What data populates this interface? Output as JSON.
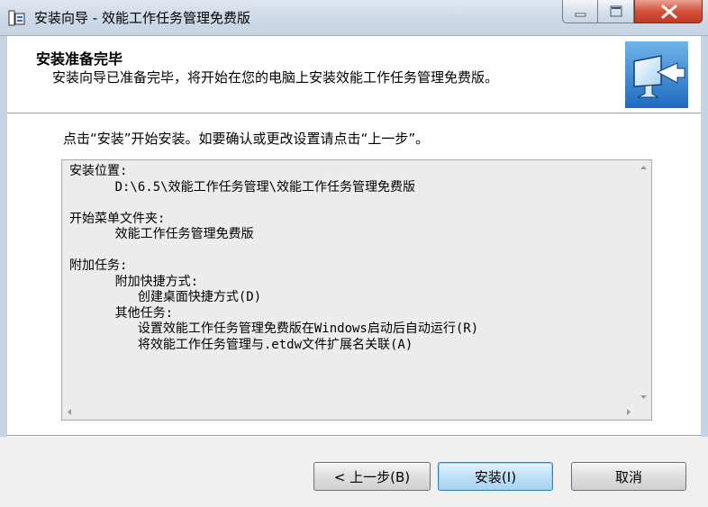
{
  "window": {
    "title": "安装向导 - 效能工作任务管理免费版"
  },
  "header": {
    "title": "安装准备完毕",
    "description": "安装向导已准备完毕，将开始在您的电脑上安装效能工作任务管理免费版。"
  },
  "body": {
    "instruction": "点击“安装”开始安装。如要确认或更改设置请点击“上一步”。",
    "memo_lines": [
      "安装位置:",
      "      D:\\6.5\\效能工作任务管理\\效能工作任务管理免费版",
      "",
      "开始菜单文件夹:",
      "      效能工作任务管理免费版",
      "",
      "附加任务:",
      "      附加快捷方式:",
      "         创建桌面快捷方式(D)",
      "      其他任务:",
      "         设置效能工作任务管理免费版在Windows启动后自动运行(R)",
      "         将效能工作任务管理与.etdw文件扩展名关联(A)"
    ]
  },
  "buttons": {
    "back": "< 上一步(B)",
    "install": "安装(I)",
    "cancel": "取消"
  },
  "icons": {
    "app": "installer-icon",
    "minimize": "minimize-icon",
    "maximize": "maximize-icon",
    "close": "close-icon",
    "header": "computer-install-icon"
  },
  "colors": {
    "titlebar": "#cdd9e6",
    "close_button": "#d4503a",
    "default_button": "#bfe0f6",
    "memo_background": "#ececec"
  }
}
